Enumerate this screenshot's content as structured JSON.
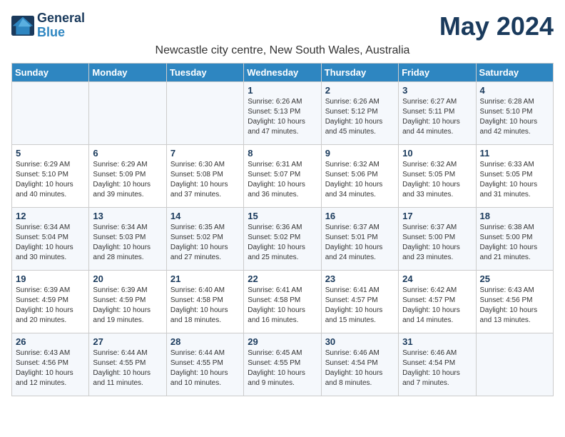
{
  "logo": {
    "general": "General",
    "blue": "Blue"
  },
  "title": "May 2024",
  "subtitle": "Newcastle city centre, New South Wales, Australia",
  "days_of_week": [
    "Sunday",
    "Monday",
    "Tuesday",
    "Wednesday",
    "Thursday",
    "Friday",
    "Saturday"
  ],
  "weeks": [
    [
      {
        "day": "",
        "info": ""
      },
      {
        "day": "",
        "info": ""
      },
      {
        "day": "",
        "info": ""
      },
      {
        "day": "1",
        "info": "Sunrise: 6:26 AM\nSunset: 5:13 PM\nDaylight: 10 hours and 47 minutes."
      },
      {
        "day": "2",
        "info": "Sunrise: 6:26 AM\nSunset: 5:12 PM\nDaylight: 10 hours and 45 minutes."
      },
      {
        "day": "3",
        "info": "Sunrise: 6:27 AM\nSunset: 5:11 PM\nDaylight: 10 hours and 44 minutes."
      },
      {
        "day": "4",
        "info": "Sunrise: 6:28 AM\nSunset: 5:10 PM\nDaylight: 10 hours and 42 minutes."
      }
    ],
    [
      {
        "day": "5",
        "info": "Sunrise: 6:29 AM\nSunset: 5:10 PM\nDaylight: 10 hours and 40 minutes."
      },
      {
        "day": "6",
        "info": "Sunrise: 6:29 AM\nSunset: 5:09 PM\nDaylight: 10 hours and 39 minutes."
      },
      {
        "day": "7",
        "info": "Sunrise: 6:30 AM\nSunset: 5:08 PM\nDaylight: 10 hours and 37 minutes."
      },
      {
        "day": "8",
        "info": "Sunrise: 6:31 AM\nSunset: 5:07 PM\nDaylight: 10 hours and 36 minutes."
      },
      {
        "day": "9",
        "info": "Sunrise: 6:32 AM\nSunset: 5:06 PM\nDaylight: 10 hours and 34 minutes."
      },
      {
        "day": "10",
        "info": "Sunrise: 6:32 AM\nSunset: 5:05 PM\nDaylight: 10 hours and 33 minutes."
      },
      {
        "day": "11",
        "info": "Sunrise: 6:33 AM\nSunset: 5:05 PM\nDaylight: 10 hours and 31 minutes."
      }
    ],
    [
      {
        "day": "12",
        "info": "Sunrise: 6:34 AM\nSunset: 5:04 PM\nDaylight: 10 hours and 30 minutes."
      },
      {
        "day": "13",
        "info": "Sunrise: 6:34 AM\nSunset: 5:03 PM\nDaylight: 10 hours and 28 minutes."
      },
      {
        "day": "14",
        "info": "Sunrise: 6:35 AM\nSunset: 5:02 PM\nDaylight: 10 hours and 27 minutes."
      },
      {
        "day": "15",
        "info": "Sunrise: 6:36 AM\nSunset: 5:02 PM\nDaylight: 10 hours and 25 minutes."
      },
      {
        "day": "16",
        "info": "Sunrise: 6:37 AM\nSunset: 5:01 PM\nDaylight: 10 hours and 24 minutes."
      },
      {
        "day": "17",
        "info": "Sunrise: 6:37 AM\nSunset: 5:00 PM\nDaylight: 10 hours and 23 minutes."
      },
      {
        "day": "18",
        "info": "Sunrise: 6:38 AM\nSunset: 5:00 PM\nDaylight: 10 hours and 21 minutes."
      }
    ],
    [
      {
        "day": "19",
        "info": "Sunrise: 6:39 AM\nSunset: 4:59 PM\nDaylight: 10 hours and 20 minutes."
      },
      {
        "day": "20",
        "info": "Sunrise: 6:39 AM\nSunset: 4:59 PM\nDaylight: 10 hours and 19 minutes."
      },
      {
        "day": "21",
        "info": "Sunrise: 6:40 AM\nSunset: 4:58 PM\nDaylight: 10 hours and 18 minutes."
      },
      {
        "day": "22",
        "info": "Sunrise: 6:41 AM\nSunset: 4:58 PM\nDaylight: 10 hours and 16 minutes."
      },
      {
        "day": "23",
        "info": "Sunrise: 6:41 AM\nSunset: 4:57 PM\nDaylight: 10 hours and 15 minutes."
      },
      {
        "day": "24",
        "info": "Sunrise: 6:42 AM\nSunset: 4:57 PM\nDaylight: 10 hours and 14 minutes."
      },
      {
        "day": "25",
        "info": "Sunrise: 6:43 AM\nSunset: 4:56 PM\nDaylight: 10 hours and 13 minutes."
      }
    ],
    [
      {
        "day": "26",
        "info": "Sunrise: 6:43 AM\nSunset: 4:56 PM\nDaylight: 10 hours and 12 minutes."
      },
      {
        "day": "27",
        "info": "Sunrise: 6:44 AM\nSunset: 4:55 PM\nDaylight: 10 hours and 11 minutes."
      },
      {
        "day": "28",
        "info": "Sunrise: 6:44 AM\nSunset: 4:55 PM\nDaylight: 10 hours and 10 minutes."
      },
      {
        "day": "29",
        "info": "Sunrise: 6:45 AM\nSunset: 4:55 PM\nDaylight: 10 hours and 9 minutes."
      },
      {
        "day": "30",
        "info": "Sunrise: 6:46 AM\nSunset: 4:54 PM\nDaylight: 10 hours and 8 minutes."
      },
      {
        "day": "31",
        "info": "Sunrise: 6:46 AM\nSunset: 4:54 PM\nDaylight: 10 hours and 7 minutes."
      },
      {
        "day": "",
        "info": ""
      }
    ]
  ]
}
